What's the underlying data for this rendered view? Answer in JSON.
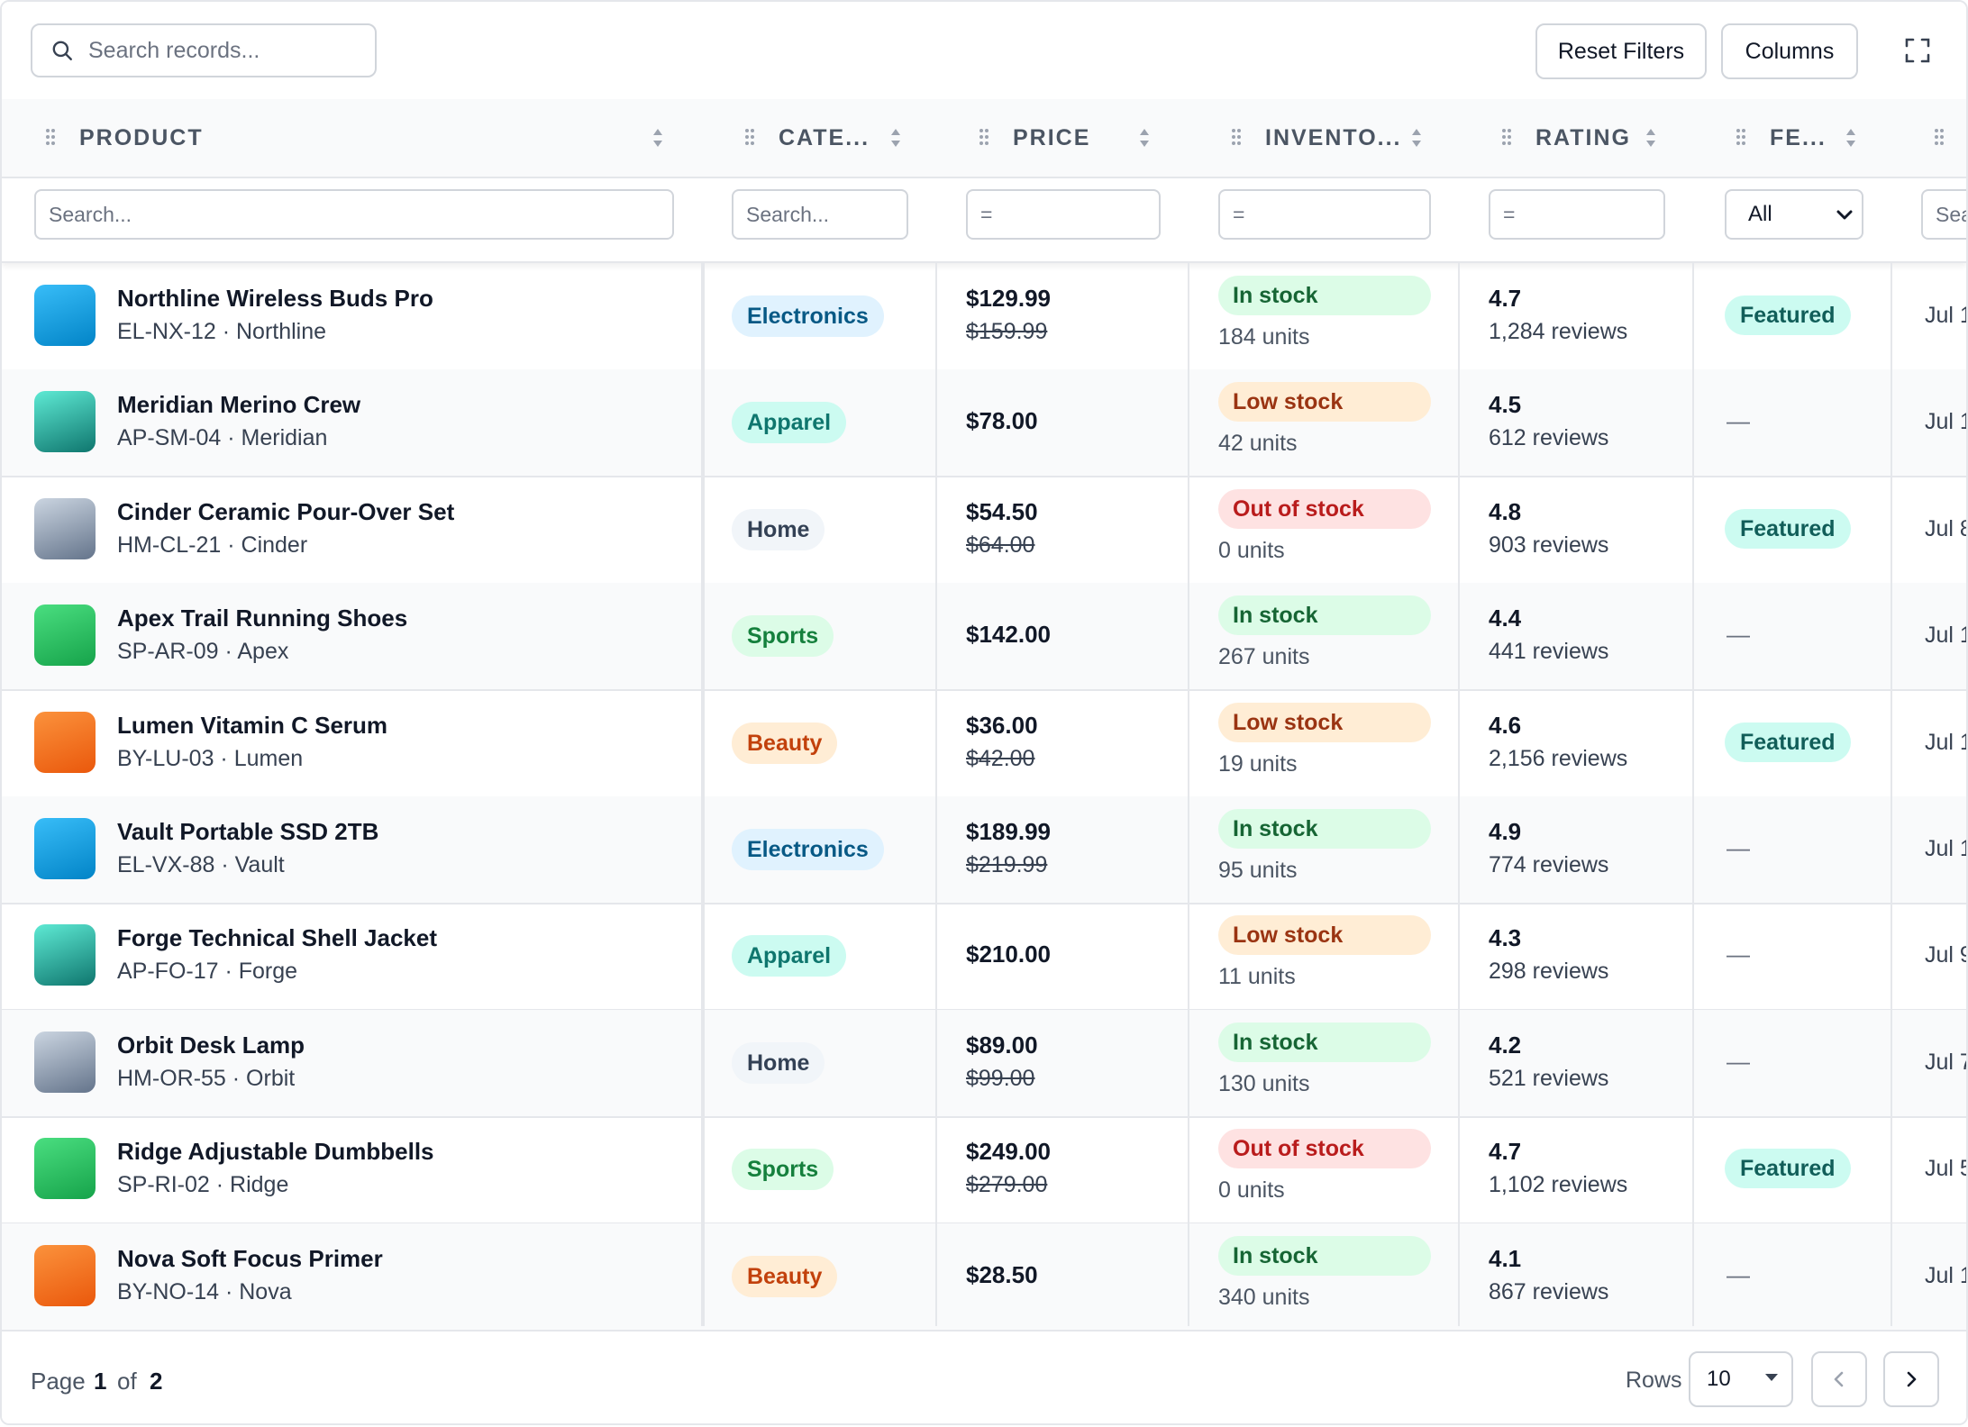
{
  "toolbar": {
    "search_placeholder": "Search records...",
    "reset_label": "Reset Filters",
    "columns_label": "Columns"
  },
  "columns": [
    {
      "label": "PRODUCT"
    },
    {
      "label": "CATE..."
    },
    {
      "label": "PRICE"
    },
    {
      "label": "INVENTO..."
    },
    {
      "label": "RATING"
    },
    {
      "label": "FE..."
    }
  ],
  "filters": {
    "product_placeholder": "Search...",
    "category_placeholder": "Search...",
    "price_placeholder": "=",
    "inventory_placeholder": "=",
    "rating_placeholder": "=",
    "featured_selected": "All",
    "date_placeholder": "Search..."
  },
  "category_colors": {
    "Electronics": {
      "bg": "#e0f2fe",
      "fg": "#075985"
    },
    "Apparel": {
      "bg": "#ccfbf1",
      "fg": "#0f766e"
    },
    "Home": {
      "bg": "#f1f5f9",
      "fg": "#334155"
    },
    "Sports": {
      "bg": "#dcfce7",
      "fg": "#15803d"
    },
    "Beauty": {
      "bg": "#ffedd5",
      "fg": "#c2410c"
    }
  },
  "stock_colors": {
    "In stock": {
      "bg": "#dcfce7",
      "fg": "#166534"
    },
    "Low stock": {
      "bg": "#ffedd5",
      "fg": "#9a3412"
    },
    "Out of stock": {
      "bg": "#fee2e2",
      "fg": "#b91c1c"
    }
  },
  "thumb_colors": {
    "Electronics": [
      "#38bdf8",
      "#0284c7"
    ],
    "Apparel": [
      "#5eead4",
      "#0f766e"
    ],
    "Home": [
      "#cbd5e1",
      "#64748b"
    ],
    "Sports": [
      "#4ade80",
      "#16a34a"
    ],
    "Beauty": [
      "#fb923c",
      "#ea580c"
    ]
  },
  "rows": [
    {
      "name": "Northline Wireless Buds Pro",
      "sku": "EL-NX-12 · Northline",
      "category": "Electronics",
      "price": "$129.99",
      "old_price": "$159.99",
      "stock": "In stock",
      "units": "184 units",
      "rating": "4.7",
      "reviews": "1,284 reviews",
      "featured": "Featured",
      "date": "Jul 1"
    },
    {
      "name": "Meridian Merino Crew",
      "sku": "AP-SM-04 · Meridian",
      "category": "Apparel",
      "price": "$78.00",
      "old_price": "",
      "stock": "Low stock",
      "units": "42 units",
      "rating": "4.5",
      "reviews": "612 reviews",
      "featured": "",
      "date": "Jul 1"
    },
    {
      "name": "Cinder Ceramic Pour-Over Set",
      "sku": "HM-CL-21 · Cinder",
      "category": "Home",
      "price": "$54.50",
      "old_price": "$64.00",
      "stock": "Out of stock",
      "units": "0 units",
      "rating": "4.8",
      "reviews": "903 reviews",
      "featured": "Featured",
      "date": "Jul 8"
    },
    {
      "name": "Apex Trail Running Shoes",
      "sku": "SP-AR-09 · Apex",
      "category": "Sports",
      "price": "$142.00",
      "old_price": "",
      "stock": "In stock",
      "units": "267 units",
      "rating": "4.4",
      "reviews": "441 reviews",
      "featured": "",
      "date": "Jul 1"
    },
    {
      "name": "Lumen Vitamin C Serum",
      "sku": "BY-LU-03 · Lumen",
      "category": "Beauty",
      "price": "$36.00",
      "old_price": "$42.00",
      "stock": "Low stock",
      "units": "19 units",
      "rating": "4.6",
      "reviews": "2,156 reviews",
      "featured": "Featured",
      "date": "Jul 1"
    },
    {
      "name": "Vault Portable SSD 2TB",
      "sku": "EL-VX-88 · Vault",
      "category": "Electronics",
      "price": "$189.99",
      "old_price": "$219.99",
      "stock": "In stock",
      "units": "95 units",
      "rating": "4.9",
      "reviews": "774 reviews",
      "featured": "",
      "date": "Jul 1"
    },
    {
      "name": "Forge Technical Shell Jacket",
      "sku": "AP-FO-17 · Forge",
      "category": "Apparel",
      "price": "$210.00",
      "old_price": "",
      "stock": "Low stock",
      "units": "11 units",
      "rating": "4.3",
      "reviews": "298 reviews",
      "featured": "",
      "date": "Jul 9"
    },
    {
      "name": "Orbit Desk Lamp",
      "sku": "HM-OR-55 · Orbit",
      "category": "Home",
      "price": "$89.00",
      "old_price": "$99.00",
      "stock": "In stock",
      "units": "130 units",
      "rating": "4.2",
      "reviews": "521 reviews",
      "featured": "",
      "date": "Jul 7"
    },
    {
      "name": "Ridge Adjustable Dumbbells",
      "sku": "SP-RI-02 · Ridge",
      "category": "Sports",
      "price": "$249.00",
      "old_price": "$279.00",
      "stock": "Out of stock",
      "units": "0 units",
      "rating": "4.7",
      "reviews": "1,102 reviews",
      "featured": "Featured",
      "date": "Jul 5"
    },
    {
      "name": "Nova Soft Focus Primer",
      "sku": "BY-NO-14 · Nova",
      "category": "Beauty",
      "price": "$28.50",
      "old_price": "",
      "stock": "In stock",
      "units": "340 units",
      "rating": "4.1",
      "reviews": "867 reviews",
      "featured": "",
      "date": "Jul 1"
    }
  ],
  "empty_marker": "—",
  "pagination": {
    "page_word": "Page",
    "current": "1",
    "of_word": "of",
    "total": "2",
    "rows_label": "Rows",
    "rows_value": "10"
  }
}
